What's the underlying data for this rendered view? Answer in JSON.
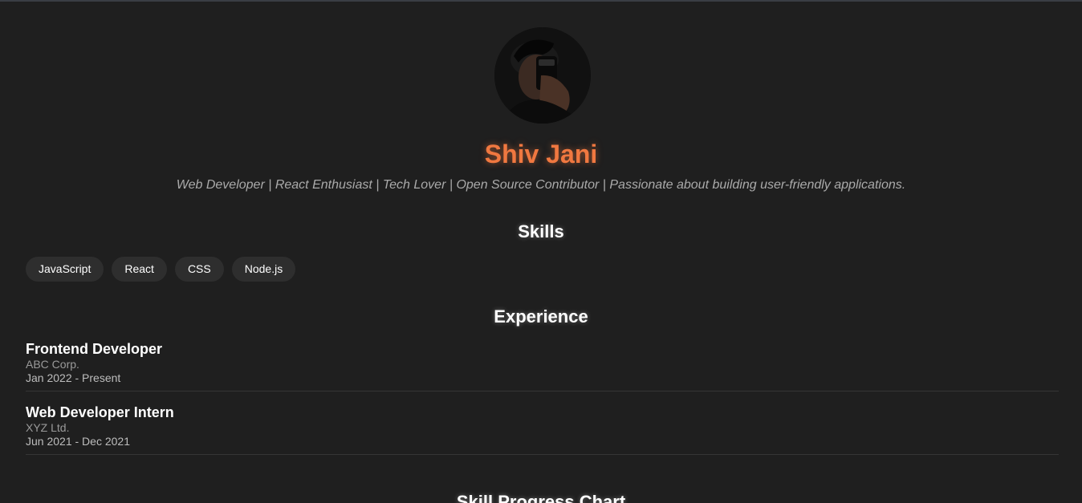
{
  "profile": {
    "name": "Shiv Jani",
    "bio": "Web Developer | React Enthusiast | Tech Lover | Open Source Contributor | Passionate about building user-friendly applications."
  },
  "skills": {
    "title": "Skills",
    "items": [
      "JavaScript",
      "React",
      "CSS",
      "Node.js"
    ]
  },
  "experience": {
    "title": "Experience",
    "items": [
      {
        "role": "Frontend Developer",
        "company": "ABC Corp.",
        "dates": "Jan 2022 - Present"
      },
      {
        "role": "Web Developer Intern",
        "company": "XYZ Ltd.",
        "dates": "Jun 2021 - Dec 2021"
      }
    ]
  },
  "chart": {
    "title": "Skill Progress Chart"
  },
  "colors": {
    "background": "#1f1f1f",
    "accent": "#f07840",
    "chip": "#2e2e2e"
  }
}
